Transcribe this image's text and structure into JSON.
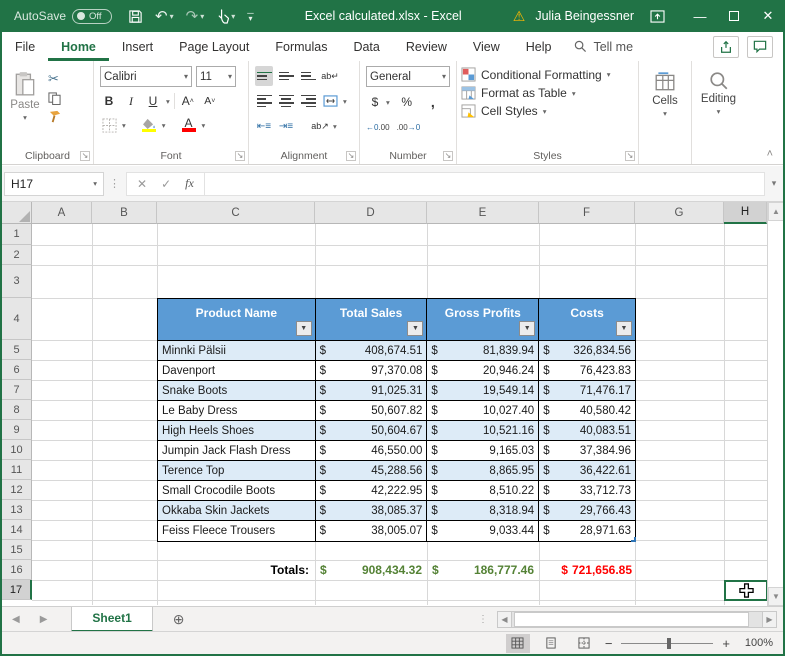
{
  "titlebar": {
    "autosave_label": "AutoSave",
    "autosave_state": "Off",
    "doc_title": "Excel calculated.xlsx  -  Excel",
    "user_name": "Julia Beingessner"
  },
  "ribbon_tabs": [
    "File",
    "Home",
    "Insert",
    "Page Layout",
    "Formulas",
    "Data",
    "Review",
    "View",
    "Help"
  ],
  "tellme_label": "Tell me",
  "ribbon": {
    "paste_label": "Paste",
    "font_name": "Calibri",
    "font_size": "11",
    "number_format": "General",
    "styles_items": [
      "Conditional Formatting",
      "Format as Table",
      "Cell Styles"
    ],
    "cells_label": "Cells",
    "editing_label": "Editing",
    "group_labels": {
      "clipboard": "Clipboard",
      "font": "Font",
      "alignment": "Alignment",
      "number": "Number",
      "styles": "Styles"
    }
  },
  "formula_bar": {
    "name_box": "H17",
    "formula": ""
  },
  "grid": {
    "columns": [
      "A",
      "B",
      "C",
      "D",
      "E",
      "F",
      "G",
      "H"
    ],
    "row_numbers": [
      "1",
      "2",
      "3",
      "4",
      "5",
      "6",
      "7",
      "8",
      "9",
      "10",
      "11",
      "12",
      "13",
      "14",
      "15",
      "16",
      "17"
    ],
    "selected_cell": "H17"
  },
  "table": {
    "currency": "$",
    "headers": [
      "Product Name",
      "Total Sales",
      "Gross Profits",
      "Costs"
    ],
    "rows": [
      {
        "name": "Minnki Pälsii",
        "sales": "408,674.51",
        "profit": "81,839.94",
        "cost": "326,834.56"
      },
      {
        "name": "Davenport",
        "sales": "97,370.08",
        "profit": "20,946.24",
        "cost": "76,423.83"
      },
      {
        "name": "Snake Boots",
        "sales": "91,025.31",
        "profit": "19,549.14",
        "cost": "71,476.17"
      },
      {
        "name": "Le Baby Dress",
        "sales": "50,607.82",
        "profit": "10,027.40",
        "cost": "40,580.42"
      },
      {
        "name": "High Heels Shoes",
        "sales": "50,604.67",
        "profit": "10,521.16",
        "cost": "40,083.51"
      },
      {
        "name": "Jumpin Jack Flash Dress",
        "sales": "46,550.00",
        "profit": "9,165.03",
        "cost": "37,384.96"
      },
      {
        "name": "Terence Top",
        "sales": "45,288.56",
        "profit": "8,865.95",
        "cost": "36,422.61"
      },
      {
        "name": "Small Crocodile Boots",
        "sales": "42,222.95",
        "profit": "8,510.22",
        "cost": "33,712.73"
      },
      {
        "name": "Okkaba Skin Jackets",
        "sales": "38,085.37",
        "profit": "8,318.94",
        "cost": "29,766.43"
      },
      {
        "name": "Feiss Fleece Trousers",
        "sales": "38,005.07",
        "profit": "9,033.44",
        "cost": "28,971.63"
      }
    ],
    "totals": {
      "label": "Totals:",
      "sales": "908,434.32",
      "profit": "186,777.46",
      "cost": "721,656.85"
    }
  },
  "sheetbar": {
    "active_sheet": "Sheet1"
  },
  "statusbar": {
    "zoom_level": "100%"
  },
  "colors": {
    "excel_green": "#217346",
    "table_header_blue": "#5B9BD5",
    "band_blue": "#DDEBF7",
    "totals_green": "#548235",
    "totals_red": "#FF0000",
    "warning_orange": "#FFB900"
  }
}
